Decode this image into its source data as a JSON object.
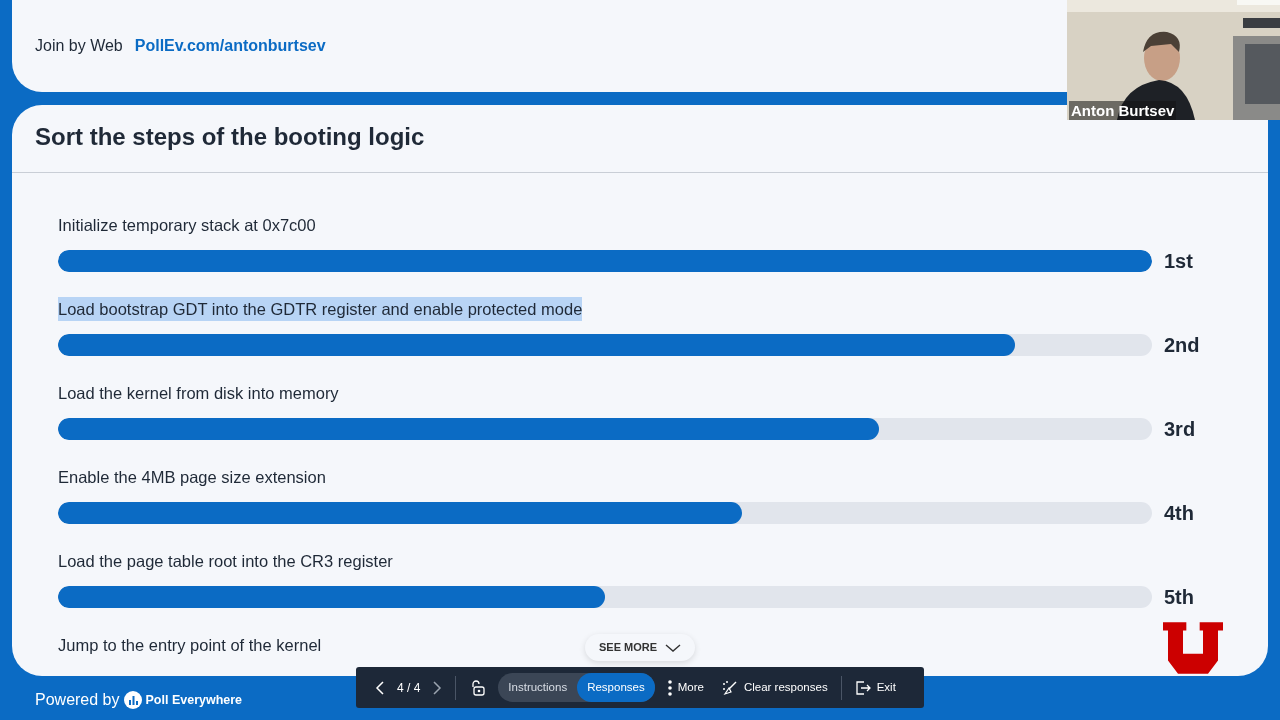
{
  "header": {
    "join_label": "Join by Web",
    "join_url": "PollEv.com/antonburtsev"
  },
  "question": {
    "title": "Sort the steps of the booting logic"
  },
  "items": [
    {
      "label": "Initialize temporary stack at 0x7c00",
      "highlighted": false,
      "level": 1.0,
      "rank": "1st"
    },
    {
      "label": "Load bootstrap GDT into the GDTR register and enable protected mode",
      "highlighted": true,
      "level": 0.875,
      "rank": "2nd"
    },
    {
      "label": "Load the kernel from disk into memory",
      "highlighted": false,
      "level": 0.75,
      "rank": "3rd"
    },
    {
      "label": "Enable the 4MB page size extension",
      "highlighted": false,
      "level": 0.625,
      "rank": "4th"
    },
    {
      "label": "Load the page table root into the CR3 register",
      "highlighted": false,
      "level": 0.5,
      "rank": "5th"
    },
    {
      "label": "Jump to the entry point of the kernel",
      "highlighted": false
    }
  ],
  "see_more": "SEE MORE",
  "toolbar": {
    "page": "4 / 4",
    "modes": [
      {
        "label": "Instructions",
        "selected": false
      },
      {
        "label": "Responses",
        "selected": true
      }
    ],
    "more": "More",
    "clear": "Clear responses",
    "exit": "Exit"
  },
  "footer": {
    "powered_by": "Powered by",
    "brand": "Poll Everywhere"
  },
  "video": {
    "kind": "picture",
    "name": "Anton Burtsev"
  }
}
